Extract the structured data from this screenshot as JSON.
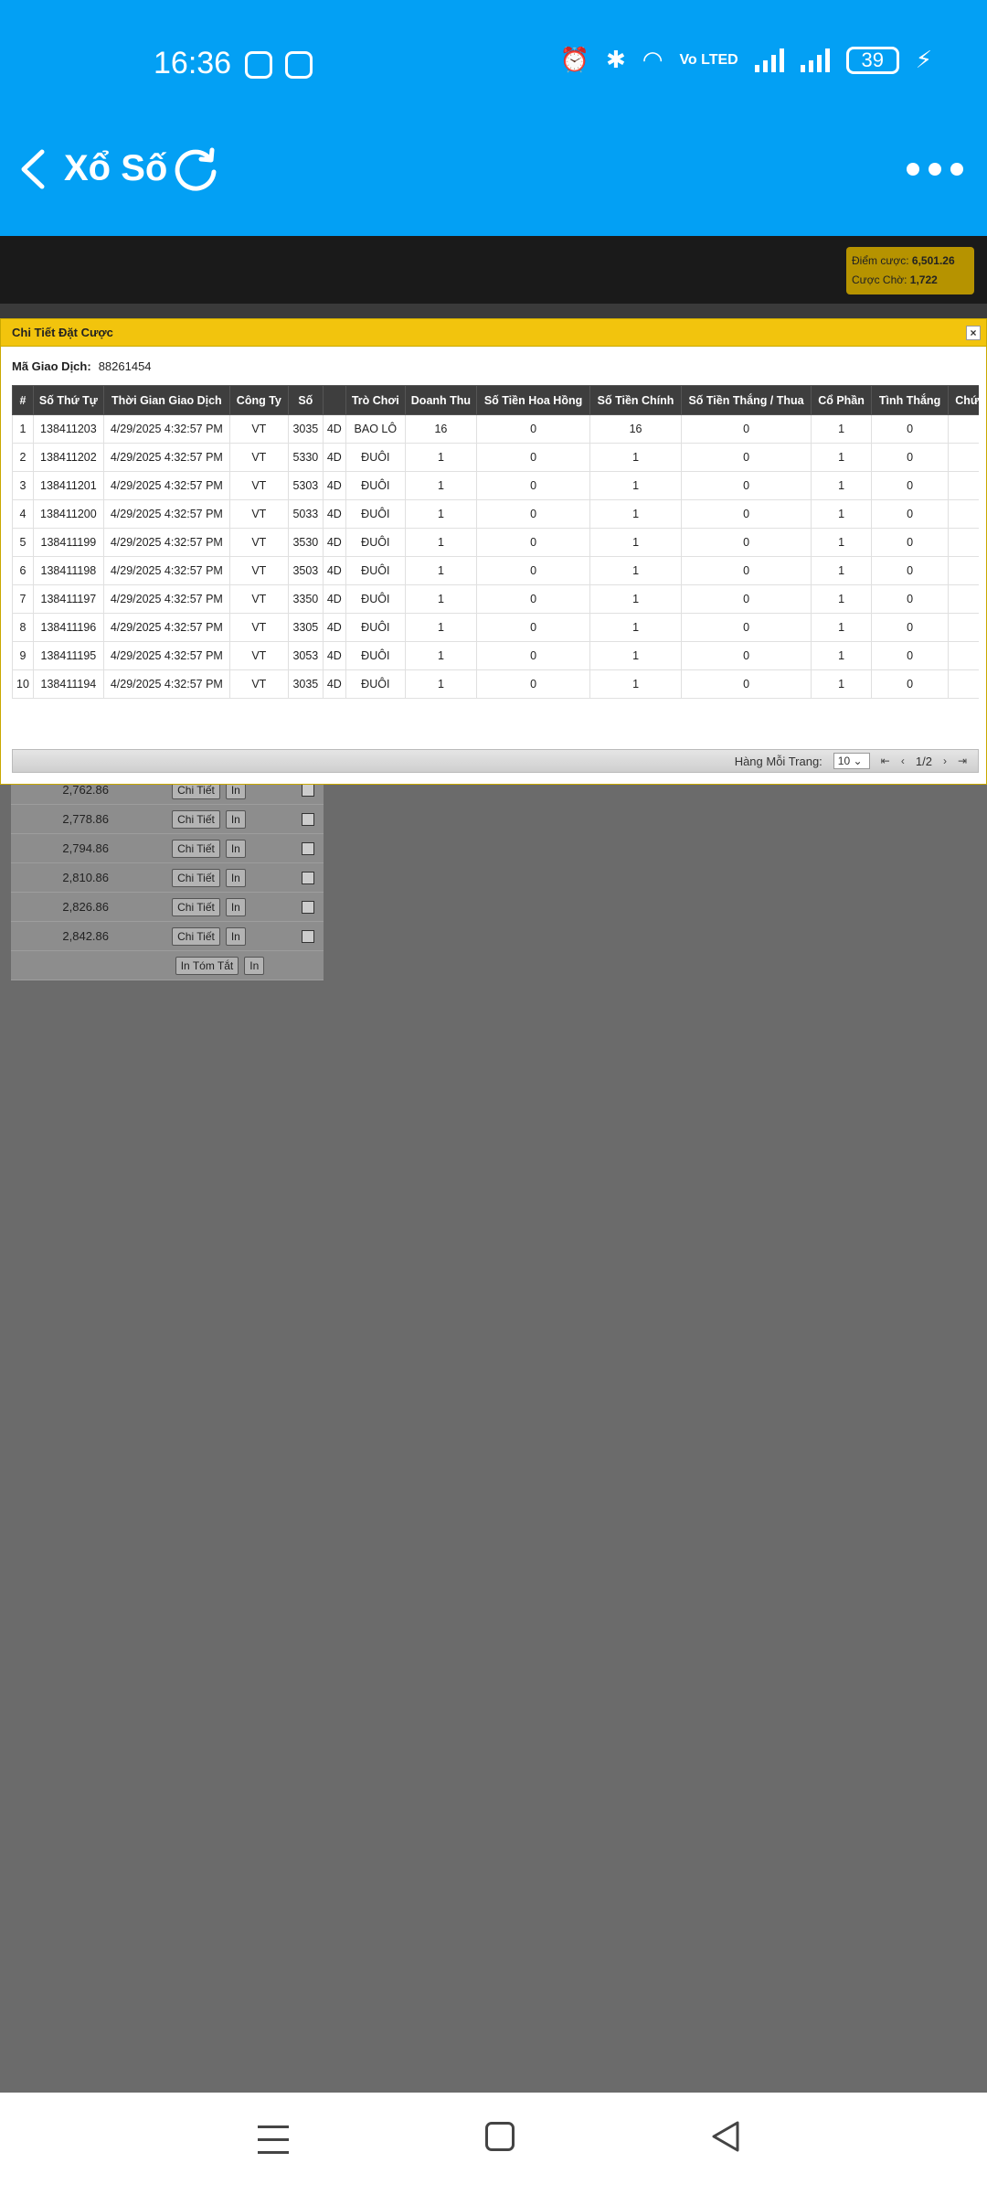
{
  "status": {
    "time": "16:36",
    "battery": "39",
    "network": "Vo LTED"
  },
  "app": {
    "title": "Xổ Số"
  },
  "balance": {
    "points_label": "Điểm cược:",
    "points_value": "6,501.26",
    "pending_label": "Cược Chờ:",
    "pending_value": "1,722"
  },
  "modal": {
    "title": "Chi Tiết Đặt Cược",
    "close": "×",
    "txn_label": "Mã Giao Dịch:",
    "txn_value": "88261454",
    "columns": [
      "#",
      "Số Thứ Tự",
      "Thời Gian Giao Dịch",
      "Công Ty",
      "Số",
      "",
      "Trò Chơi",
      "Doanh Thu",
      "Số Tiền Hoa Hồng",
      "Số Tiền Chính",
      "Số Tiền Thắng / Thua",
      "Cổ Phần",
      "Tình Thắng",
      "Chức"
    ],
    "rows": [
      [
        "1",
        "138411203",
        "4/29/2025 4:32:57 PM",
        "VT",
        "3035",
        "4D",
        "BAO LÔ",
        "16",
        "0",
        "16",
        "0",
        "1",
        "0",
        ""
      ],
      [
        "2",
        "138411202",
        "4/29/2025 4:32:57 PM",
        "VT",
        "5330",
        "4D",
        "ĐUÔI",
        "1",
        "0",
        "1",
        "0",
        "1",
        "0",
        ""
      ],
      [
        "3",
        "138411201",
        "4/29/2025 4:32:57 PM",
        "VT",
        "5303",
        "4D",
        "ĐUÔI",
        "1",
        "0",
        "1",
        "0",
        "1",
        "0",
        ""
      ],
      [
        "4",
        "138411200",
        "4/29/2025 4:32:57 PM",
        "VT",
        "5033",
        "4D",
        "ĐUÔI",
        "1",
        "0",
        "1",
        "0",
        "1",
        "0",
        ""
      ],
      [
        "5",
        "138411199",
        "4/29/2025 4:32:57 PM",
        "VT",
        "3530",
        "4D",
        "ĐUÔI",
        "1",
        "0",
        "1",
        "0",
        "1",
        "0",
        ""
      ],
      [
        "6",
        "138411198",
        "4/29/2025 4:32:57 PM",
        "VT",
        "3503",
        "4D",
        "ĐUÔI",
        "1",
        "0",
        "1",
        "0",
        "1",
        "0",
        ""
      ],
      [
        "7",
        "138411197",
        "4/29/2025 4:32:57 PM",
        "VT",
        "3350",
        "4D",
        "ĐUÔI",
        "1",
        "0",
        "1",
        "0",
        "1",
        "0",
        ""
      ],
      [
        "8",
        "138411196",
        "4/29/2025 4:32:57 PM",
        "VT",
        "3305",
        "4D",
        "ĐUÔI",
        "1",
        "0",
        "1",
        "0",
        "1",
        "0",
        ""
      ],
      [
        "9",
        "138411195",
        "4/29/2025 4:32:57 PM",
        "VT",
        "3053",
        "4D",
        "ĐUÔI",
        "1",
        "0",
        "1",
        "0",
        "1",
        "0",
        ""
      ],
      [
        "10",
        "138411194",
        "4/29/2025 4:32:57 PM",
        "VT",
        "3035",
        "4D",
        "ĐUÔI",
        "1",
        "0",
        "1",
        "0",
        "1",
        "0",
        ""
      ]
    ],
    "pager": {
      "rows_label": "Hàng Mỗi Trang:",
      "rows_value": "10",
      "page": "1/2"
    }
  },
  "background": {
    "amounts": [
      "2,762.86",
      "2,778.86",
      "2,794.86",
      "2,810.86",
      "2,826.86",
      "2,842.86"
    ],
    "detail_label": "Chi Tiết",
    "print_label": "In",
    "summary_label": "In Tóm Tắt",
    "summary_print_label": "In"
  }
}
